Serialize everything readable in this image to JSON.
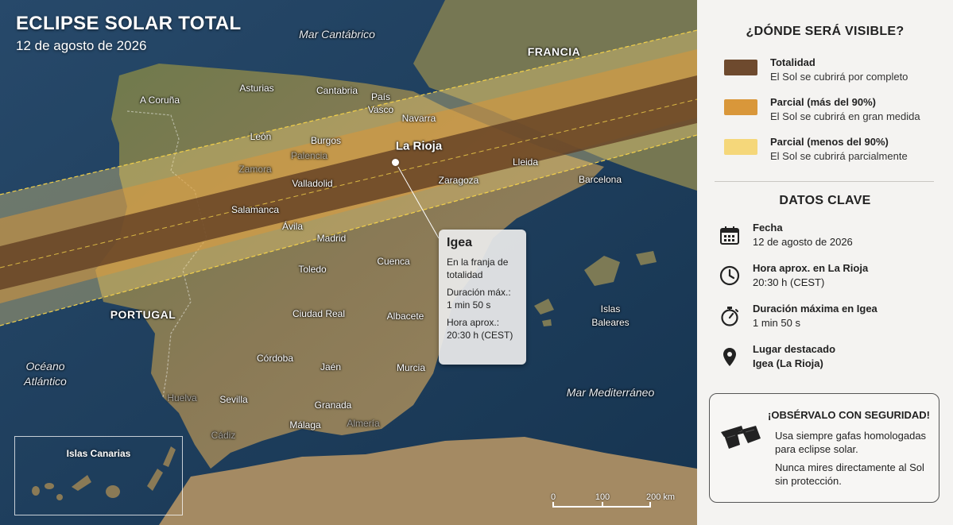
{
  "title": {
    "main": "ECLIPSE SOLAR TOTAL",
    "date": "12 de agosto de 2026"
  },
  "map": {
    "seas": {
      "cantabrico": "Mar Cantábrico",
      "atlantico_1": "Océano",
      "atlantico_2": "Atlántico",
      "mediterraneo": "Mar Mediterráneo"
    },
    "countries": {
      "francia": "FRANCIA",
      "portugal": "PORTUGAL"
    },
    "cities": {
      "a_coruna": "A Coruña",
      "asturias": "Asturias",
      "cantabria": "Cantabria",
      "pais_vasco_1": "País",
      "pais_vasco_2": "Vasco",
      "navarra": "Navarra",
      "leon": "León",
      "burgos": "Burgos",
      "palencia": "Palencia",
      "zamora": "Zamora",
      "valladolid": "Valladolid",
      "la_rioja": "La Rioja",
      "zaragoza": "Zaragoza",
      "lleida": "Lleida",
      "barcelona": "Barcelona",
      "salamanca": "Salamanca",
      "avila": "Ávila",
      "madrid": "Madrid",
      "cuenca": "Cuenca",
      "toledo": "Toledo",
      "ciudad_real": "Ciudad Real",
      "albacete": "Albacete",
      "cordoba": "Córdoba",
      "jaen": "Jaén",
      "murcia": "Murcia",
      "huelva": "Huelva",
      "sevilla": "Sevilla",
      "granada": "Granada",
      "cadiz": "Cádiz",
      "malaga": "Málaga",
      "almeria": "Almería",
      "islas_baleares_1": "Islas",
      "islas_baleares_2": "Baleares"
    },
    "canarias_label": "Islas Canarias",
    "scale": {
      "labels": [
        "0",
        "100",
        "200 km"
      ]
    }
  },
  "callout": {
    "title": "Igea",
    "line1": "En la franja de",
    "line2": "totalidad",
    "line3": "Duración máx.:",
    "line4": "1 min 50 s",
    "line5": "Hora aprox.:",
    "line6": "20:30 h (CEST)"
  },
  "sidebar": {
    "visibility_heading": "¿DÓNDE SERÁ VISIBLE?",
    "legend": [
      {
        "title": "Totalidad",
        "desc": "El Sol se cubrirá por completo",
        "color": "#6e4a2e"
      },
      {
        "title": "Parcial (más del 90%)",
        "desc": "El Sol se cubrirá en gran medida",
        "color": "#d9973a"
      },
      {
        "title": "Parcial (menos del 90%)",
        "desc": "El Sol se cubrirá parcialmente",
        "color": "#f5d77a"
      }
    ],
    "key_data_heading": "DATOS CLAVE",
    "key_data": [
      {
        "icon": "calendar-icon",
        "title": "Fecha",
        "value": "12 de agosto de 2026"
      },
      {
        "icon": "clock-icon",
        "title": "Hora aprox. en La Rioja",
        "value": "20:30 h (CEST)"
      },
      {
        "icon": "stopwatch-icon",
        "title": "Duración máxima en Igea",
        "value": "1 min 50 s"
      },
      {
        "icon": "location-pin-icon",
        "title": "Lugar destacado",
        "value": "Igea (La Rioja)"
      }
    ],
    "safety": {
      "title": "¡OBSÉRVALO CON SEGURIDAD!",
      "text1": "Usa siempre gafas homologadas para eclipse solar.",
      "text2": "Nunca mires directamente al Sol sin protección."
    }
  }
}
